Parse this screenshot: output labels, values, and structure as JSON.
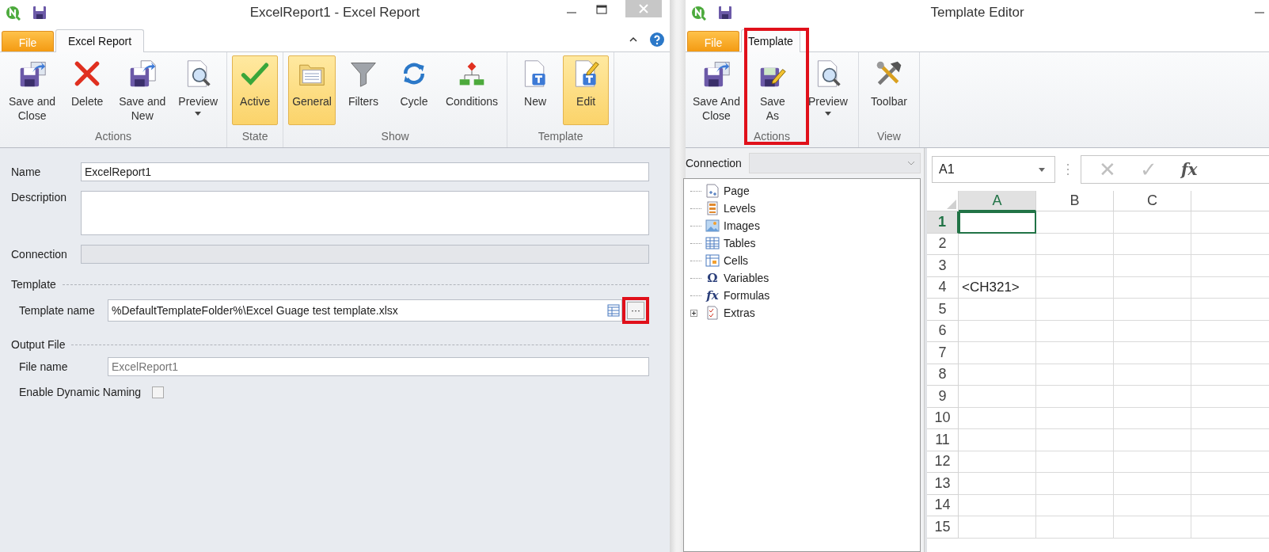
{
  "left_window": {
    "title": "ExcelReport1 - Excel Report",
    "tabs": [
      {
        "label": "File",
        "kind": "file",
        "selected": false
      },
      {
        "label": "Excel Report",
        "kind": "ribbon",
        "selected": true
      }
    ],
    "ribbon_groups": [
      {
        "label": "Actions",
        "buttons": [
          {
            "lines": [
              "Save and",
              "Close"
            ],
            "selected": false,
            "dropdown": false
          },
          {
            "lines": [
              "Delete"
            ],
            "selected": false,
            "dropdown": false
          },
          {
            "lines": [
              "Save and",
              "New"
            ],
            "selected": false,
            "dropdown": false
          },
          {
            "lines": [
              "Preview"
            ],
            "selected": false,
            "dropdown": true
          }
        ]
      },
      {
        "label": "State",
        "buttons": [
          {
            "lines": [
              "Active"
            ],
            "selected": true,
            "dropdown": false
          }
        ]
      },
      {
        "label": "Show",
        "buttons": [
          {
            "lines": [
              "General"
            ],
            "selected": true,
            "dropdown": false
          },
          {
            "lines": [
              "Filters"
            ],
            "selected": false,
            "dropdown": false
          },
          {
            "lines": [
              "Cycle"
            ],
            "selected": false,
            "dropdown": false
          },
          {
            "lines": [
              "Conditions"
            ],
            "selected": false,
            "dropdown": false
          }
        ]
      },
      {
        "label": "Template",
        "buttons": [
          {
            "lines": [
              "New"
            ],
            "selected": false,
            "dropdown": false
          },
          {
            "lines": [
              "Edit"
            ],
            "selected": true,
            "dropdown": false
          }
        ]
      }
    ],
    "form": {
      "name": {
        "label": "Name",
        "value": "ExcelReport1"
      },
      "description": {
        "label": "Description"
      },
      "connection": {
        "label": "Connection",
        "disabled": true
      },
      "template_section": "Template",
      "template_name": {
        "label": "Template name",
        "value": "%DefaultTemplateFolder%\\Excel Guage test template.xlsx",
        "browse_button": "···",
        "highlighted": true
      },
      "output_section": "Output File",
      "file_name": {
        "label": "File name",
        "placeholder": "ExcelReport1"
      },
      "dynamic_naming": {
        "label": "Enable Dynamic Naming",
        "checked": false
      }
    }
  },
  "right_window": {
    "title": "Template Editor",
    "tabs": [
      {
        "label": "File",
        "kind": "file",
        "selected": false
      },
      {
        "label": "Template",
        "kind": "ribbon",
        "selected": true
      }
    ],
    "ribbon_groups": [
      {
        "label": "Actions",
        "buttons": [
          {
            "lines": [
              "Save And",
              "Close"
            ],
            "selected": false,
            "dropdown": false,
            "highlighted": false
          },
          {
            "lines": [
              "Save",
              "As"
            ],
            "selected": false,
            "dropdown": false,
            "highlighted": true
          },
          {
            "lines": [
              "Preview"
            ],
            "selected": false,
            "dropdown": true,
            "highlighted": false
          }
        ]
      },
      {
        "label": "View",
        "buttons": [
          {
            "lines": [
              "Toolbar"
            ],
            "selected": false,
            "dropdown": false,
            "highlighted": false
          }
        ]
      }
    ],
    "connection": {
      "label": "Connection",
      "disabled": true
    },
    "tree": [
      {
        "label": "Page",
        "expandable": false
      },
      {
        "label": "Levels",
        "expandable": false
      },
      {
        "label": "Images",
        "expandable": false
      },
      {
        "label": "Tables",
        "expandable": false
      },
      {
        "label": "Cells",
        "expandable": false
      },
      {
        "label": "Variables",
        "glyph": "Ω",
        "expandable": false
      },
      {
        "label": "Formulas",
        "glyph": "fx",
        "expandable": false
      },
      {
        "label": "Extras",
        "expandable": true
      }
    ],
    "sheet": {
      "name_box": "A1",
      "cancel": "✕",
      "enter": "✓",
      "function": "fx",
      "columns": [
        {
          "label": "A",
          "selected": true
        },
        {
          "label": "B",
          "selected": false
        },
        {
          "label": "C",
          "selected": false
        }
      ],
      "rows": [
        {
          "label": "1",
          "selected": true
        },
        {
          "label": "2",
          "selected": false
        },
        {
          "label": "3",
          "selected": false
        },
        {
          "label": "4",
          "selected": false,
          "cells": [
            "<CH321>"
          ]
        },
        {
          "label": "5",
          "selected": false
        },
        {
          "label": "6",
          "selected": false
        },
        {
          "label": "7",
          "selected": false
        },
        {
          "label": "8",
          "selected": false
        },
        {
          "label": "9",
          "selected": false
        },
        {
          "label": "10",
          "selected": false
        },
        {
          "label": "11",
          "selected": false
        },
        {
          "label": "12",
          "selected": false
        },
        {
          "label": "13",
          "selected": false
        },
        {
          "label": "14",
          "selected": false
        },
        {
          "label": "15",
          "selected": false
        }
      ]
    }
  }
}
